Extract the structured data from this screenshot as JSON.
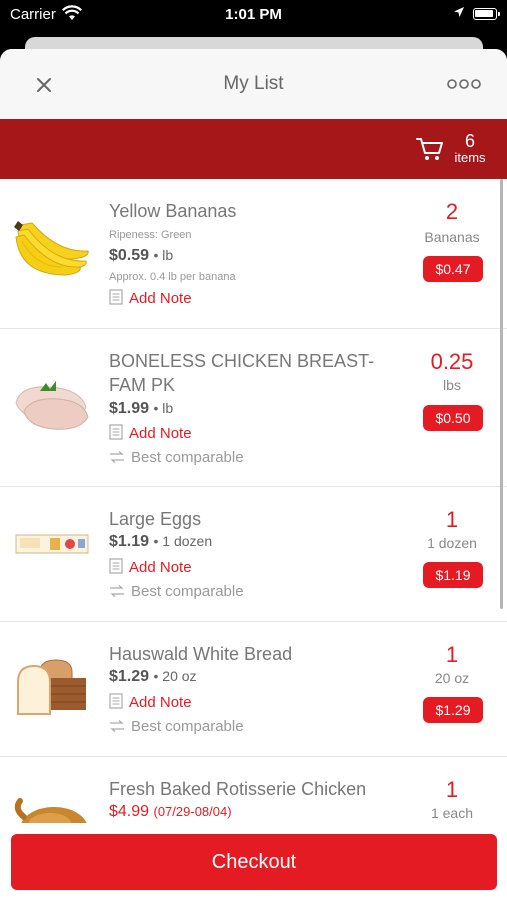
{
  "status_bar": {
    "carrier": "Carrier",
    "time": "1:01 PM"
  },
  "nav": {
    "title": "My List"
  },
  "banner": {
    "item_count": "6",
    "item_label": "items"
  },
  "items": [
    {
      "image": "bananas",
      "name": "Yellow Bananas",
      "detail": "Ripeness: Green",
      "price": "$0.59",
      "unit": "• lb",
      "approx": "Approx. 0.4 lb per banana",
      "note": "Add Note",
      "qty": "2",
      "qty_unit": "Bananas",
      "total": "$0.47"
    },
    {
      "image": "chicken-breast",
      "name": "BONELESS CHICKEN BREAST-FAM PK",
      "price": "$1.99",
      "unit": "• lb",
      "note": "Add Note",
      "comparable": "Best comparable",
      "qty": "0.25",
      "qty_unit": "lbs",
      "total": "$0.50"
    },
    {
      "image": "eggs",
      "name": "Large Eggs",
      "price": "$1.19",
      "unit": "• 1 dozen",
      "note": "Add Note",
      "comparable": "Best comparable",
      "qty": "1",
      "qty_unit": "1 dozen",
      "total": "$1.19"
    },
    {
      "image": "bread",
      "name": "Hauswald White Bread",
      "price": "$1.29",
      "unit": "• 20 oz",
      "note": "Add Note",
      "comparable": "Best comparable",
      "qty": "1",
      "qty_unit": "20 oz",
      "total": "$1.29"
    },
    {
      "image": "rotisserie-chicken",
      "name": "Fresh Baked Rotisserie Chicken",
      "price": "$4.99",
      "date_range": "(07/29-08/04)",
      "qty": "1",
      "qty_unit": "1 each"
    }
  ],
  "footer": {
    "checkout_label": "Checkout"
  },
  "colors": {
    "brand_red": "#e41b23",
    "banner_red": "#a51719"
  }
}
